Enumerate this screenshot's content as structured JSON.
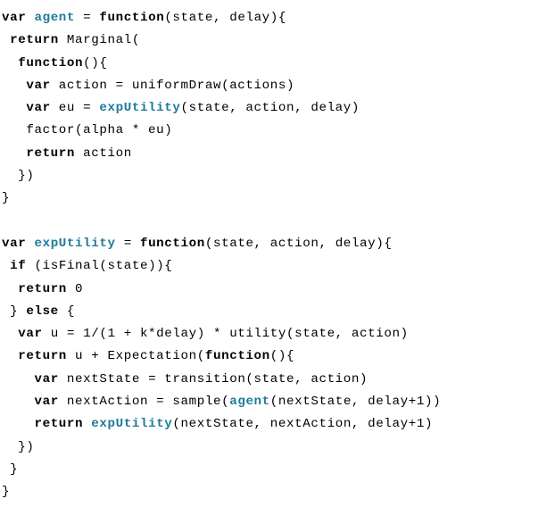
{
  "colors": {
    "keyword": "#000000",
    "funcname": "#1f7a99",
    "text": "#000000",
    "bg": "#ffffff"
  },
  "tokens": {
    "kw_var": "var",
    "kw_function": "function",
    "kw_return": "return",
    "kw_if": "if",
    "kw_else": "else",
    "fn_agent": "agent",
    "fn_expUtility": "expUtility"
  },
  "lines": {
    "l1a": " = ",
    "l1b": "(state, delay){",
    "l2": " Marginal(",
    "l3a": "  ",
    "l3b": "(){",
    "l4a": "   ",
    "l4b": " action = uniformDraw(actions)",
    "l5a": "   ",
    "l5b": " eu = ",
    "l5c": "(state, action, delay)",
    "l6": "   factor(alpha * eu)",
    "l7a": "   ",
    "l7b": " action",
    "l8": "  })",
    "l9": "}",
    "l10": "",
    "l11a": " = ",
    "l11b": "(state, action, delay){",
    "l12a": " ",
    "l12b": " (isFinal(state)){",
    "l13a": "  ",
    "l13b": " 0",
    "l14a": " } ",
    "l14b": " {",
    "l15a": "  ",
    "l15b": " u = 1/(1 + k*delay) * utility(state, action)",
    "l16a": "  ",
    "l16b": " u + Expectation(",
    "l16c": "(){",
    "l17a": "    ",
    "l17b": " nextState = transition(state, action)",
    "l18a": "    ",
    "l18b": " nextAction = sample(",
    "l18c": "(nextState, delay+1))",
    "l19a": "    ",
    "l19b": " ",
    "l19c": "(nextState, nextAction, delay+1)",
    "l20": "  })",
    "l21": " }",
    "l22": "}"
  }
}
